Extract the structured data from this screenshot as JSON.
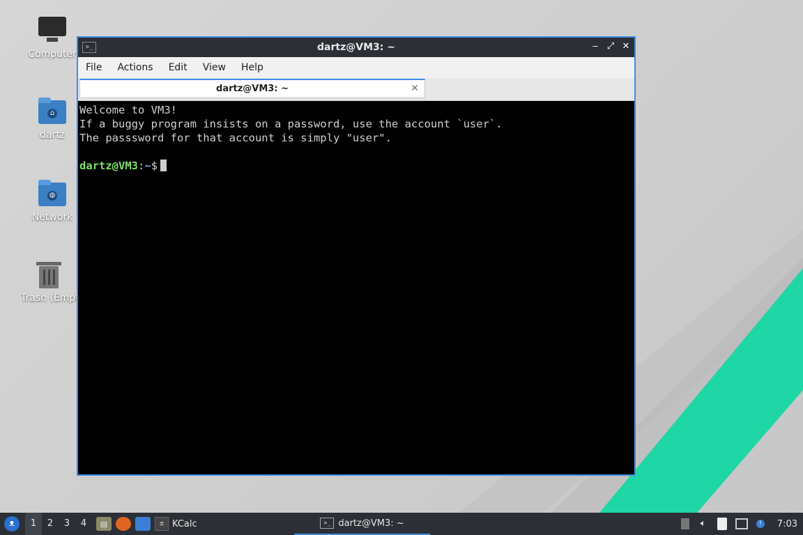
{
  "desktop": {
    "icons": [
      {
        "label": "Computer"
      },
      {
        "label": "dartz"
      },
      {
        "label": "Network"
      },
      {
        "label": "Trash (Empty)"
      }
    ]
  },
  "window": {
    "title": "dartz@VM3: ~",
    "titlebar_icon": ">_",
    "buttons": {
      "minimize": "‒",
      "maximize": "⤢",
      "close": "✕"
    },
    "menu": [
      "File",
      "Actions",
      "Edit",
      "View",
      "Help"
    ],
    "tab": {
      "label": "dartz@VM3: ~",
      "close": "✕"
    }
  },
  "terminal": {
    "lines": [
      "Welcome to VM3!",
      "If a buggy program insists on a password, use the account `user`.",
      "The passsword for that account is simply \"user\".",
      ""
    ],
    "prompt_user": "dartz@VM3",
    "prompt_sep": ":",
    "prompt_path": "~",
    "prompt_symbol": "$"
  },
  "taskbar": {
    "workspaces": [
      "1",
      "2",
      "3",
      "4"
    ],
    "active_workspace": "1",
    "kcalc_label": "KCalc",
    "task_label": "dartz@VM3: ~",
    "clock": "7:03"
  },
  "colors": {
    "accent": "#3d8ee6",
    "prompt_user": "#7ee06c",
    "prompt_path": "#6aa6ff",
    "mint_stripe": "#23d4a4"
  }
}
